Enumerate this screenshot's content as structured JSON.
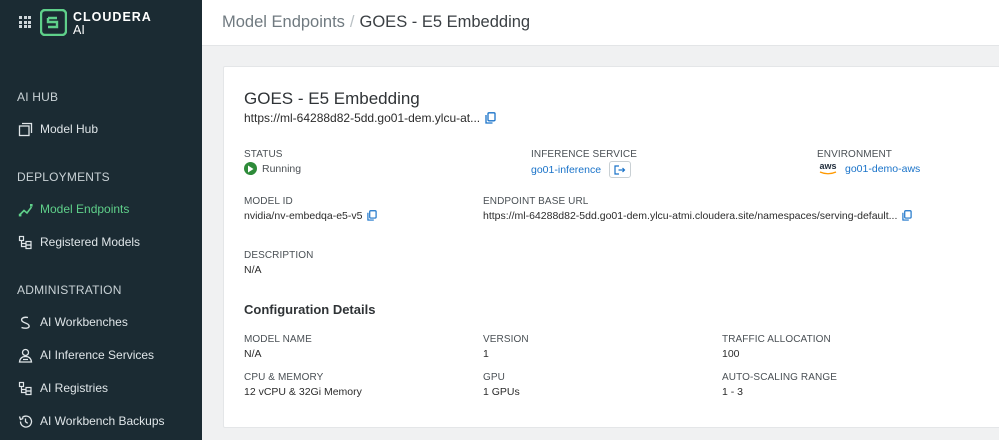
{
  "brand": {
    "name": "CLOUDERA",
    "sub": "AI"
  },
  "sidebar": {
    "sections": [
      {
        "label": "AI HUB",
        "items": [
          {
            "label": "Model Hub",
            "icon": "model-hub-icon"
          }
        ]
      },
      {
        "label": "DEPLOYMENTS",
        "items": [
          {
            "label": "Model Endpoints",
            "icon": "model-endpoints-icon",
            "active": true
          },
          {
            "label": "Registered Models",
            "icon": "registered-models-icon"
          }
        ]
      },
      {
        "label": "ADMINISTRATION",
        "items": [
          {
            "label": "AI Workbenches",
            "icon": "workbenches-icon"
          },
          {
            "label": "AI Inference Services",
            "icon": "inference-services-icon"
          },
          {
            "label": "AI Registries",
            "icon": "registries-icon"
          },
          {
            "label": "AI Workbench Backups",
            "icon": "backups-icon"
          }
        ]
      }
    ]
  },
  "breadcrumb": {
    "parent": "Model Endpoints",
    "separator": "/",
    "current": "GOES - E5 Embedding"
  },
  "endpoint": {
    "title": "GOES - E5 Embedding",
    "url": "https://ml-64288d82-5dd.go01-dem.ylcu-at...",
    "status_label": "STATUS",
    "status_value": "Running",
    "inference_label": "INFERENCE SERVICE",
    "inference_value": "go01-inference",
    "environment_label": "ENVIRONMENT",
    "environment_value": "go01-demo-aws",
    "environment_provider": "aws",
    "model_id_label": "MODEL ID",
    "model_id_value": "nvidia/nv-embedqa-e5-v5",
    "base_url_label": "ENDPOINT BASE URL",
    "base_url_value": "https://ml-64288d82-5dd.go01-dem.ylcu-atmi.cloudera.site/namespaces/serving-default...",
    "description_label": "DESCRIPTION",
    "description_value": "N/A"
  },
  "config": {
    "title": "Configuration Details",
    "model_name_label": "MODEL NAME",
    "model_name_value": "N/A",
    "version_label": "VERSION",
    "version_value": "1",
    "traffic_label": "TRAFFIC ALLOCATION",
    "traffic_value": "100",
    "cpu_label": "CPU & MEMORY",
    "cpu_value": "12 vCPU & 32Gi Memory",
    "gpu_label": "GPU",
    "gpu_value": "1 GPUs",
    "autoscale_label": "AUTO-SCALING RANGE",
    "autoscale_value": "1 - 3"
  },
  "colors": {
    "sidebar_bg": "#1b2b33",
    "accent_green": "#5fd08a",
    "link_blue": "#1a73c9",
    "status_green": "#2e8b3a"
  }
}
